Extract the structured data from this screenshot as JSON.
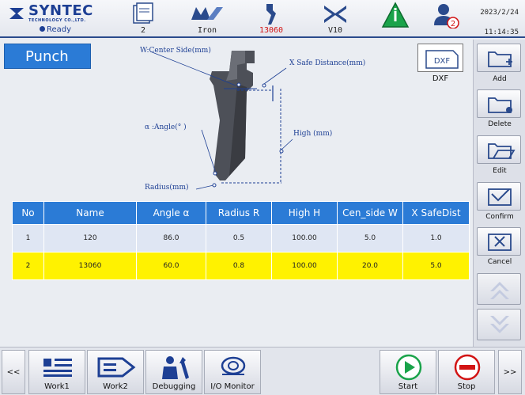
{
  "header": {
    "brand": "SYNTEC",
    "brand_sub": "TECHNOLOGY CO.,LTD.",
    "status": "Ready",
    "items": [
      {
        "value": "2",
        "icon": "program-icon"
      },
      {
        "value": "Iron",
        "icon": "material-icon"
      },
      {
        "value": "13060",
        "icon": "punch-tool-icon",
        "color": "#d21414"
      },
      {
        "value": "V10",
        "icon": "die-icon"
      },
      {
        "value": "",
        "icon": "info-warning-icon"
      },
      {
        "value": "2",
        "icon": "user-alarm-icon"
      }
    ],
    "date": "2023/2/24",
    "time": "11:14:35"
  },
  "page": {
    "title": "Punch",
    "dxf_label": "DXF",
    "dxf_button_text": "DXF"
  },
  "diagram": {
    "w_label": "W:Center Side(mm)",
    "x_label": "X Safe Distance(mm)",
    "angle_label": "α :Angle(° )",
    "high_label": "High (mm)",
    "radius_label": "Radius(mm)"
  },
  "table": {
    "columns": [
      "No",
      "Name",
      "Angle α",
      "Radius R",
      "High H",
      "Cen_side W",
      "X SafeDist"
    ],
    "rows": [
      [
        "1",
        "120",
        "86.0",
        "0.5",
        "100.00",
        "5.0",
        "1.0"
      ],
      [
        "2",
        "13060",
        "60.0",
        "0.8",
        "100.00",
        "20.0",
        "5.0"
      ]
    ],
    "selected_row": 2,
    "selected_color": "#fff200",
    "header_color": "#2b7bd6"
  },
  "sidebar": {
    "add": "Add",
    "delete": "Delete",
    "edit": "Edit",
    "confirm": "Confirm",
    "cancel": "Cancel"
  },
  "bottom": {
    "prev": "<<",
    "next": ">>",
    "work1": "Work1",
    "work2": "Work2",
    "debugging": "Debugging",
    "io_monitor": "I/O Monitor",
    "start": "Start",
    "stop": "Stop"
  }
}
